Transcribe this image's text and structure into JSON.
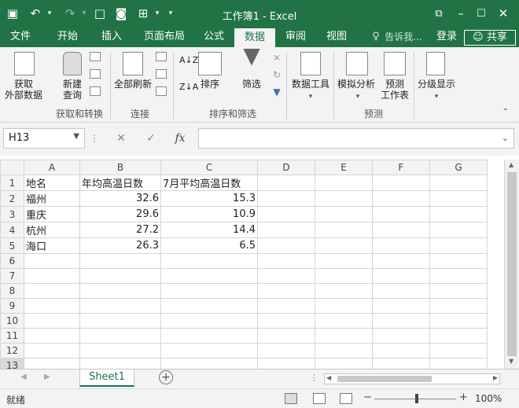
{
  "window": {
    "title": "工作簿1 - Excel"
  },
  "titlebar_icons": [
    "save-icon",
    "undo-icon",
    "redo-icon",
    "new-file-icon",
    "camera-icon",
    "sheet-icon",
    "customize-icon"
  ],
  "tabs": [
    "文件",
    "开始",
    "插入",
    "页面布局",
    "公式",
    "数据",
    "审阅",
    "视图"
  ],
  "active_tab": "数据",
  "tell_me": "告诉我...",
  "login": "登录",
  "share": "共享",
  "ribbon": {
    "get_external": "获取\n外部数据",
    "new_query": "新建\n查询",
    "group_get": "获取和转换",
    "refresh_all": "全部刷新",
    "group_conn": "连接",
    "sort": "排序",
    "filter": "筛选",
    "group_sort": "排序和筛选",
    "data_tools": "数据工具",
    "whatif": "模拟分析",
    "forecast": "预测\n工作表",
    "group_forecast": "预测",
    "outline": "分级显示"
  },
  "formula_bar": {
    "name_box": "H13",
    "fx": "fx",
    "content": ""
  },
  "columns": [
    "A",
    "B",
    "C",
    "D",
    "E",
    "F",
    "G"
  ],
  "rows": [
    [
      "地名",
      "年均高温日数",
      "7月平均高温日数",
      "",
      "",
      "",
      ""
    ],
    [
      "福州",
      "32.6",
      "15.3",
      "",
      "",
      "",
      ""
    ],
    [
      "重庆",
      "29.6",
      "10.9",
      "",
      "",
      "",
      ""
    ],
    [
      "杭州",
      "27.2",
      "14.4",
      "",
      "",
      "",
      ""
    ],
    [
      "海口",
      "26.3",
      "6.5",
      "",
      "",
      "",
      ""
    ],
    [
      "",
      "",
      "",
      "",
      "",
      "",
      ""
    ],
    [
      "",
      "",
      "",
      "",
      "",
      "",
      ""
    ],
    [
      "",
      "",
      "",
      "",
      "",
      "",
      ""
    ],
    [
      "",
      "",
      "",
      "",
      "",
      "",
      ""
    ],
    [
      "",
      "",
      "",
      "",
      "",
      "",
      ""
    ],
    [
      "",
      "",
      "",
      "",
      "",
      "",
      ""
    ],
    [
      "",
      "",
      "",
      "",
      "",
      "",
      ""
    ],
    [
      "",
      "",
      "",
      "",
      "",
      "",
      ""
    ]
  ],
  "row_numbers": [
    "1",
    "2",
    "3",
    "4",
    "5",
    "6",
    "7",
    "8",
    "9",
    "10",
    "11",
    "12",
    "13"
  ],
  "sheet_tab": "Sheet1",
  "status": {
    "text": "就绪",
    "zoom": "100%"
  }
}
